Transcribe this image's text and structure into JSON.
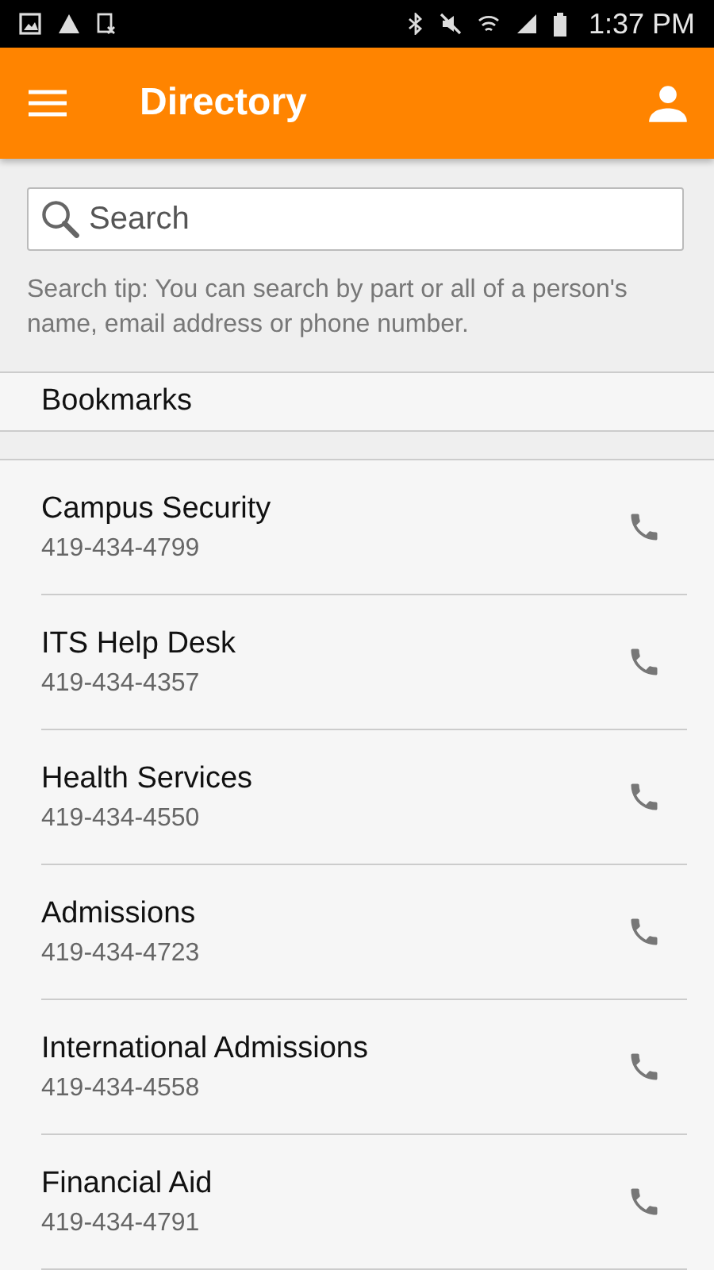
{
  "status_bar": {
    "time": "1:37 PM"
  },
  "app_bar": {
    "title": "Directory"
  },
  "search": {
    "placeholder": "Search",
    "tip": "Search tip: You can search by part or all of a person's name, email address or phone number."
  },
  "bookmarks": {
    "label": "Bookmarks"
  },
  "contacts": [
    {
      "name": "Campus Security",
      "phone": "419-434-4799"
    },
    {
      "name": "ITS Help Desk",
      "phone": "419-434-4357"
    },
    {
      "name": "Health Services",
      "phone": "419-434-4550"
    },
    {
      "name": "Admissions",
      "phone": "419-434-4723"
    },
    {
      "name": "International Admissions",
      "phone": "419-434-4558"
    },
    {
      "name": "Financial Aid",
      "phone": "419-434-4791"
    }
  ]
}
